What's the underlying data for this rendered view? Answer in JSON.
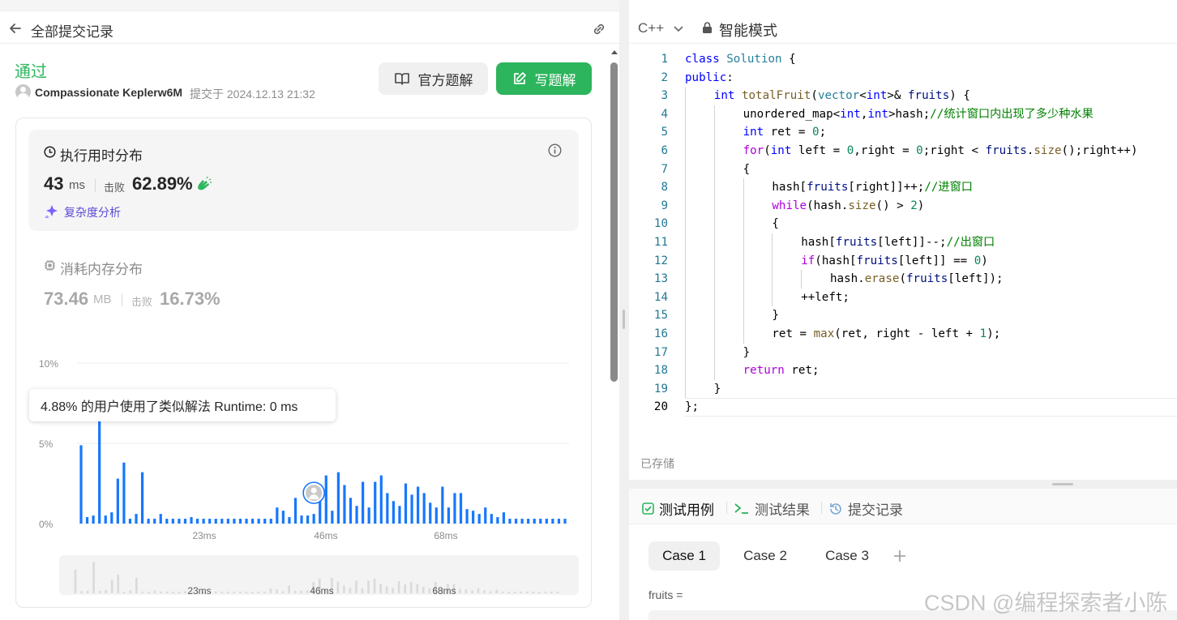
{
  "left_header": {
    "title": "全部提交记录"
  },
  "submission": {
    "status": "通过",
    "user": "Compassionate Keplerw6M",
    "submitted_at": "提交于 2024.12.13 21:32",
    "official_solution_label": "官方题解",
    "write_solution_label": "写题解"
  },
  "runtime": {
    "title": "执行用时分布",
    "value": "43",
    "unit": "ms",
    "beat_label": "击败",
    "beat_pct": "62.89%",
    "complexity_label": "复杂度分析"
  },
  "memory": {
    "title": "消耗内存分布",
    "value": "73.46",
    "unit": "MB",
    "beat_label": "击败",
    "beat_pct": "16.73%"
  },
  "tooltip": "4.88% 的用户使用了类似解法 Runtime: 0 ms",
  "chart_data": {
    "type": "bar",
    "ylabel": "",
    "xlabel": "",
    "y_ticks": [
      "10%",
      "5%",
      "0%"
    ],
    "x_ticks": [
      "23ms",
      "46ms",
      "68ms"
    ],
    "ylim": [
      0,
      10
    ],
    "values": [
      4.88,
      0.4,
      0.5,
      6.4,
      0.5,
      0.7,
      2.8,
      3.8,
      0.3,
      0.6,
      3.2,
      0.3,
      0.3,
      0.6,
      0.3,
      0.3,
      0.3,
      0.3,
      0.4,
      0.3,
      0.3,
      0.3,
      0.3,
      0.3,
      0.3,
      0.3,
      0.3,
      0.3,
      0.3,
      0.3,
      0.3,
      0.3,
      1.0,
      0.8,
      0.4,
      1.6,
      0.5,
      0.5,
      0.6,
      2.3,
      3.0,
      0.8,
      3.2,
      2.4,
      1.6,
      1.1,
      2.6,
      1.0,
      2.6,
      3.0,
      1.9,
      1.4,
      1.1,
      2.5,
      1.8,
      2.3,
      1.9,
      1.3,
      1.0,
      2.3,
      1.0,
      1.9,
      1.9,
      0.9,
      0.8,
      0.6,
      1.0,
      0.6,
      0.4,
      0.7,
      0.3,
      0.3,
      0.3,
      0.3,
      0.3,
      0.3,
      0.3,
      0.3,
      0.3,
      0.3
    ],
    "highlight_bin_index": 38,
    "accent": "#1677ff"
  },
  "minimap": {
    "x_ticks": [
      "23ms",
      "46ms",
      "68ms"
    ]
  },
  "editor": {
    "language": "C++",
    "mode": "智能模式",
    "saved_label": "已存储",
    "lines": [
      {
        "n": "1",
        "indent": 0,
        "html": "<span style='color:#0000ff'>class</span> <span style='color:#267f99'>Solution</span> {"
      },
      {
        "n": "2",
        "indent": 0,
        "html": "<span style='color:#0000ff'>public</span>:"
      },
      {
        "n": "3",
        "indent": 1,
        "html": "<span style='color:#0000ff'>int</span> <span style='color:#795e26'>totalFruit</span>(<span style='color:#267f99'>vector</span>&lt;<span style='color:#0000ff'>int</span>&gt;&amp; <span style='color:#001080'>fruits</span>) {"
      },
      {
        "n": "4",
        "indent": 2,
        "html": "unordered_map&lt;<span style='color:#0000ff'>int</span>,<span style='color:#0000ff'>int</span>&gt;hash;<span style='color:#008000'>//统计窗口内出现了多少种水果</span>"
      },
      {
        "n": "5",
        "indent": 2,
        "html": "<span style='color:#0000ff'>int</span> ret = <span style='color:#098658'>0</span>;"
      },
      {
        "n": "6",
        "indent": 2,
        "html": "<span style='color:#af00db'>for</span>(<span style='color:#0000ff'>int</span> left = <span style='color:#098658'>0</span>,right = <span style='color:#098658'>0</span>;right &lt; <span style='color:#001080'>fruits</span>.<span style='color:#795e26'>size</span>();right++)"
      },
      {
        "n": "7",
        "indent": 2,
        "html": "{"
      },
      {
        "n": "8",
        "indent": 3,
        "html": "hash[<span style='color:#001080'>fruits</span>[right]]++;<span style='color:#008000'>//进窗口</span>"
      },
      {
        "n": "9",
        "indent": 3,
        "html": "<span style='color:#af00db'>while</span>(hash.<span style='color:#795e26'>size</span>() &gt; <span style='color:#098658'>2</span>)"
      },
      {
        "n": "10",
        "indent": 3,
        "html": "{"
      },
      {
        "n": "11",
        "indent": 4,
        "html": "hash[<span style='color:#001080'>fruits</span>[left]]--;<span style='color:#008000'>//出窗口</span>"
      },
      {
        "n": "12",
        "indent": 4,
        "html": "<span style='color:#af00db'>if</span>(hash[<span style='color:#001080'>fruits</span>[left]] == <span style='color:#098658'>0</span>)"
      },
      {
        "n": "13",
        "indent": 5,
        "html": "hash.<span style='color:#795e26'>erase</span>(<span style='color:#001080'>fruits</span>[left]);"
      },
      {
        "n": "14",
        "indent": 4,
        "html": "++left;"
      },
      {
        "n": "15",
        "indent": 3,
        "html": "}"
      },
      {
        "n": "16",
        "indent": 3,
        "html": "ret = <span style='color:#795e26'>max</span>(ret, right - left + <span style='color:#098658'>1</span>);"
      },
      {
        "n": "17",
        "indent": 2,
        "html": "}"
      },
      {
        "n": "18",
        "indent": 2,
        "html": "<span style='color:#af00db'>return</span> ret;"
      },
      {
        "n": "19",
        "indent": 1,
        "html": "}"
      },
      {
        "n": "20",
        "indent": 0,
        "html": "};"
      }
    ]
  },
  "bottom_tabs": [
    {
      "label": "测试用例"
    },
    {
      "label": "测试结果"
    },
    {
      "label": "提交记录"
    }
  ],
  "cases": [
    {
      "label": "Case 1",
      "active": true
    },
    {
      "label": "Case 2",
      "active": false
    },
    {
      "label": "Case 3",
      "active": false
    }
  ],
  "param_label": "fruits =",
  "watermark": "CSDN @编程探索者小陈"
}
